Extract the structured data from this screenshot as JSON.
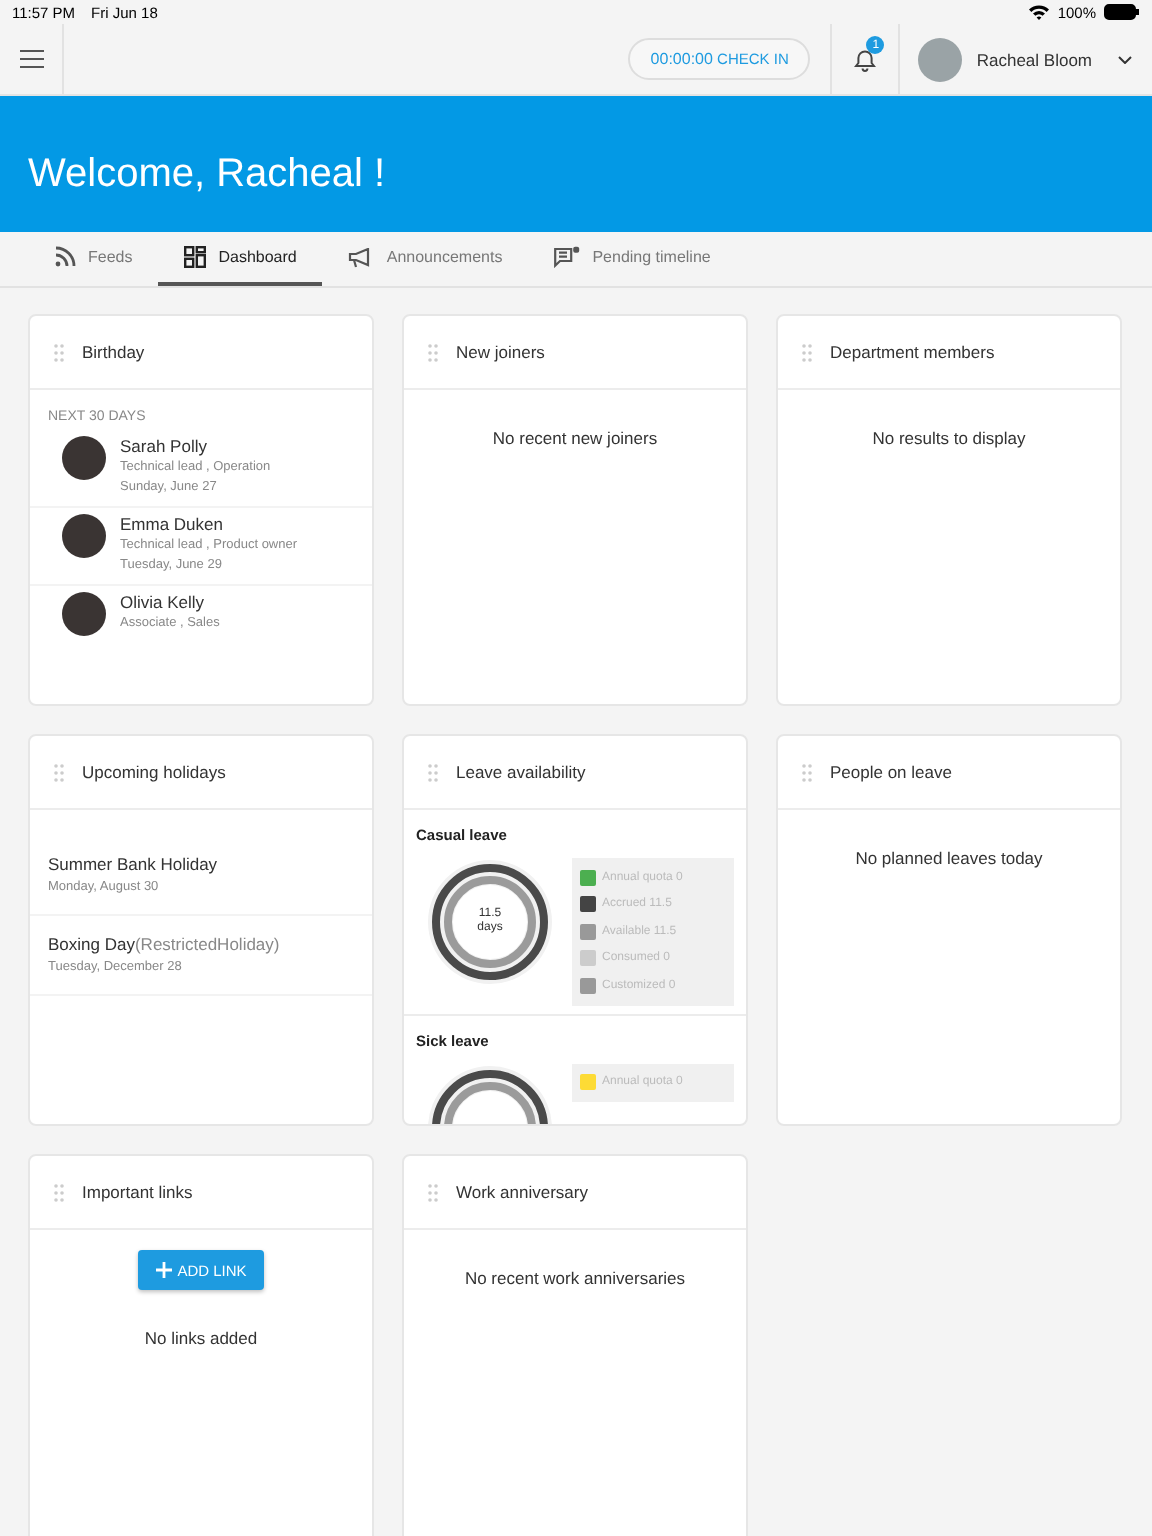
{
  "status_bar": {
    "time": "11:57 PM",
    "date": "Fri Jun 18",
    "battery": "100%"
  },
  "header": {
    "timer": "00:00:00",
    "check_in": "CHECK IN",
    "notifications": "1",
    "user": "Racheal Bloom"
  },
  "banner": {
    "title": "Welcome, Racheal !"
  },
  "tabs": [
    {
      "label": "Feeds",
      "selected": false
    },
    {
      "label": "Dashboard",
      "selected": true
    },
    {
      "label": "Announcements",
      "selected": false
    },
    {
      "label": "Pending timeline",
      "selected": false
    }
  ],
  "widgets": [
    {
      "kind": "birthday",
      "title": "Birthday",
      "subtitle": "NEXT 30 DAYS",
      "people": [
        {
          "name": "Sarah Polly",
          "role": "Technical lead , Operation",
          "date": "Sunday, June 27"
        },
        {
          "name": "Emma Duken",
          "role": "Technical lead , Product owner",
          "date": "Tuesday, June 29"
        },
        {
          "name": "Olivia Kelly",
          "role": "Associate , Sales"
        }
      ]
    },
    {
      "kind": "empty",
      "title": "New joiners",
      "message": "No recent new joiners"
    },
    {
      "kind": "empty",
      "title": "Department members",
      "message": "No results to display"
    },
    {
      "kind": "holidays",
      "title": "Upcoming holidays",
      "holidays": [
        {
          "name": "Summer Bank Holiday",
          "date": "Monday, August 30"
        },
        {
          "name": "Boxing Day",
          "note": "(RestrictedHoliday)",
          "date": "Tuesday, December 28"
        }
      ]
    },
    {
      "kind": "leave",
      "title": "Leave availability",
      "sections": [
        {
          "name": "Casual leave",
          "center": "11.5",
          "unit": "days",
          "legend": [
            {
              "label": "Annual quota 0",
              "color": "#4caf50"
            },
            {
              "label": "Accrued 11.5",
              "color": "#444444"
            },
            {
              "label": "Available 11.5",
              "color": "#999999"
            },
            {
              "label": "Consumed 0",
              "color": "#cccccc"
            },
            {
              "label": "Customized 0",
              "color": "#999999"
            }
          ]
        },
        {
          "name": "Sick leave",
          "legend": [
            {
              "label": "Annual quota 0",
              "color": "#fddb35"
            }
          ]
        }
      ]
    },
    {
      "kind": "empty",
      "title": "People on leave",
      "message": "No planned leaves today"
    },
    {
      "kind": "links",
      "title": "Important links",
      "button": "ADD LINK",
      "message": "No links added"
    },
    {
      "kind": "empty",
      "title": "Work anniversary",
      "message": "No recent work anniversaries"
    }
  ]
}
